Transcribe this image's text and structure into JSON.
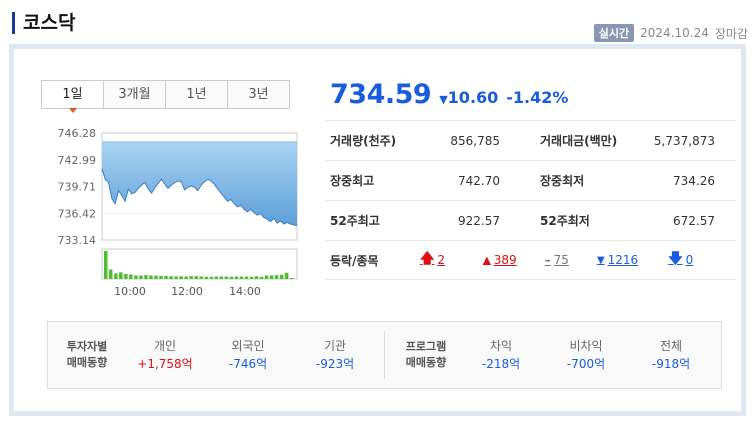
{
  "title": "코스닥",
  "status": {
    "badge": "실시간",
    "date": "2024.10.24",
    "state": "장마감"
  },
  "tabs": [
    "1일",
    "3개월",
    "1년",
    "3년"
  ],
  "price": {
    "value": "734.59",
    "change": "10.60",
    "pct": "-1.42%"
  },
  "stats": [
    {
      "l1": "거래량(천주)",
      "v1": "856,785",
      "l2": "거래대금(백만)",
      "v2": "5,737,873"
    },
    {
      "l1": "장중최고",
      "v1": "742.70",
      "l2": "장중최저",
      "v2": "734.26"
    },
    {
      "l1": "52주최고",
      "v1": "922.57",
      "l2": "52주최저",
      "v2": "672.57"
    }
  ],
  "rise_fall": {
    "label": "등락/종목",
    "upper": "2",
    "up": "389",
    "flat": "75",
    "down": "1216",
    "lower": "0"
  },
  "investor": {
    "label1": "투자자별",
    "label2": "매매동향",
    "cols": [
      {
        "h": "개인",
        "v": "+1,758억"
      },
      {
        "h": "외국인",
        "v": "-746억"
      },
      {
        "h": "기관",
        "v": "-923억"
      }
    ]
  },
  "program": {
    "label1": "프로그램",
    "label2": "매매동향",
    "cols": [
      {
        "h": "차익",
        "v": "-218억"
      },
      {
        "h": "비차익",
        "v": "-700억"
      },
      {
        "h": "전체",
        "v": "-918억"
      }
    ]
  },
  "chart_data": {
    "type": "area",
    "y_ticks": [
      "746.28",
      "742.99",
      "739.71",
      "736.42",
      "733.14"
    ],
    "x_ticks": [
      "10:00",
      "12:00",
      "14:00"
    ],
    "ylim": [
      733.14,
      746.28
    ],
    "prev_close": 745.19,
    "values": [
      741.9,
      740.6,
      740.2,
      738.2,
      737.6,
      739.2,
      738.6,
      737.9,
      739.4,
      738.8,
      739.0,
      739.5,
      739.9,
      740.2,
      739.4,
      738.9,
      739.6,
      740.1,
      740.6,
      740.0,
      739.5,
      739.9,
      740.2,
      740.4,
      740.3,
      739.3,
      739.6,
      739.8,
      739.6,
      739.2,
      739.9,
      740.3,
      740.6,
      740.4,
      740.0,
      739.4,
      738.9,
      738.4,
      737.9,
      738.1,
      737.6,
      737.2,
      737.4,
      736.9,
      736.6,
      736.9,
      736.5,
      736.2,
      736.4,
      735.9,
      735.7,
      735.4,
      735.8,
      735.2,
      735.5,
      735.1,
      735.3,
      735.1,
      735.0,
      734.9
    ],
    "volume": [
      1.0,
      0.34,
      0.2,
      0.24,
      0.18,
      0.16,
      0.13,
      0.12,
      0.14,
      0.13,
      0.12,
      0.11,
      0.11,
      0.1,
      0.09,
      0.1,
      0.09,
      0.1,
      0.1,
      0.09,
      0.08,
      0.08,
      0.09,
      0.09,
      0.09,
      0.08,
      0.09,
      0.09,
      0.09,
      0.08,
      0.1,
      0.08,
      0.13,
      0.13,
      0.14,
      0.15,
      0.22,
      0.04
    ]
  },
  "colors": {
    "accent": "#1a5ce0",
    "up": "#dd1111",
    "down": "#1a5ce0",
    "volume": "#4dbe2e"
  }
}
